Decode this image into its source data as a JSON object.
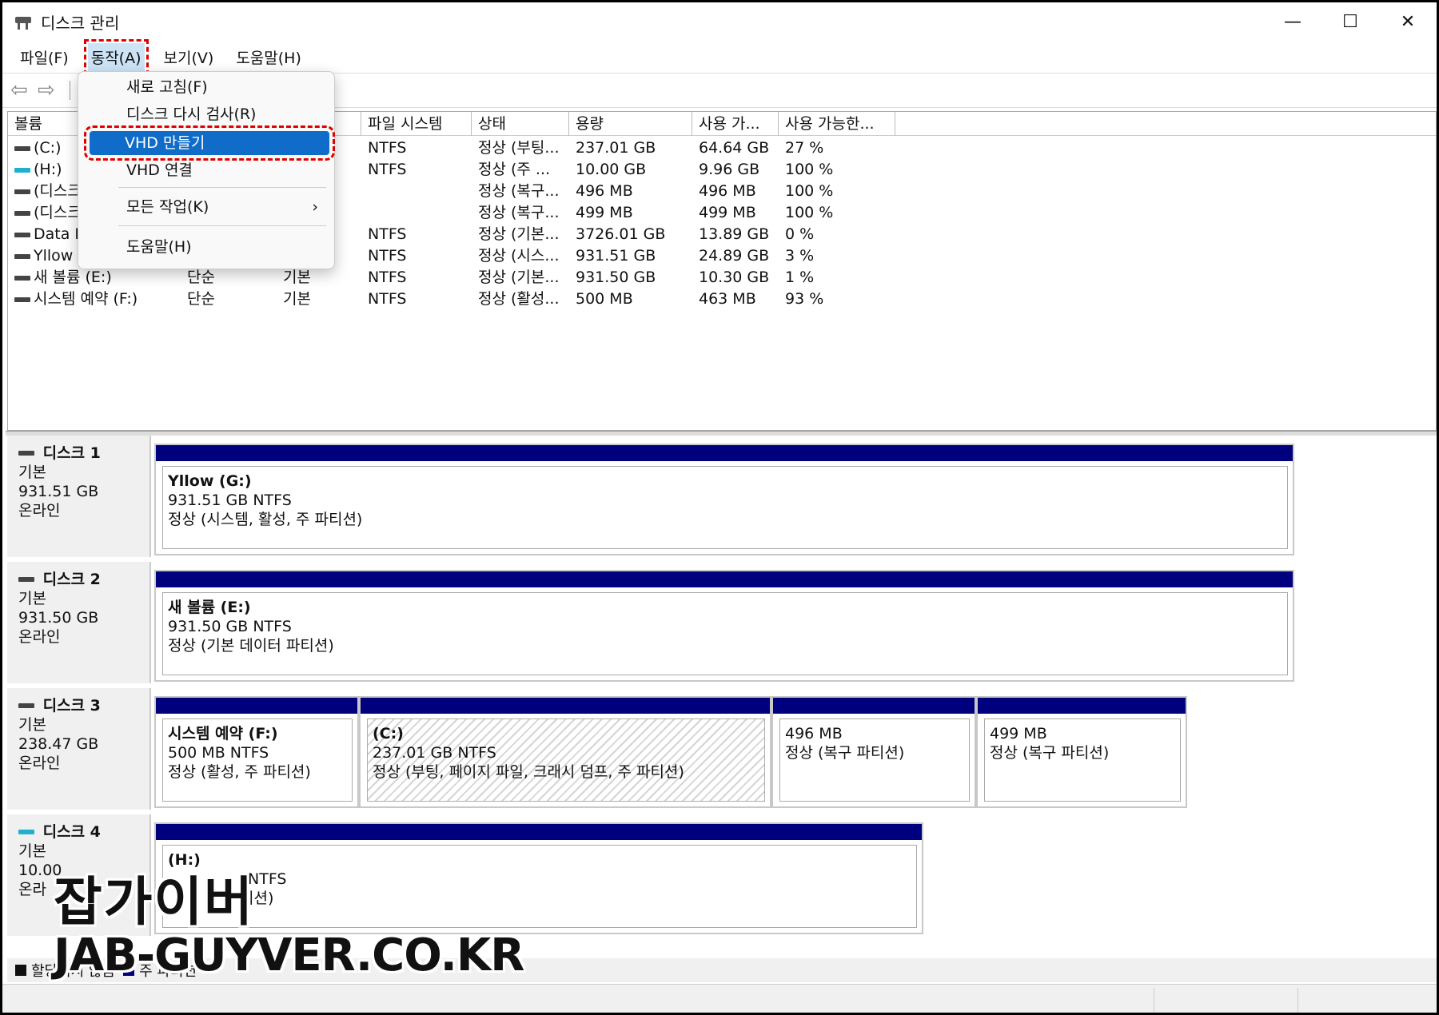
{
  "window": {
    "title": "디스크 관리",
    "minimize": "—",
    "maximize": "☐",
    "close": "✕"
  },
  "menubar": [
    "파일(F)",
    "동작(A)",
    "보기(V)",
    "도움말(H)"
  ],
  "toolbar": {
    "back": "⇦",
    "forward": "⇨"
  },
  "columns": [
    "볼륨",
    "",
    "",
    "파일 시스템",
    "상태",
    "용량",
    "사용 가...",
    "사용 가능한..."
  ],
  "volumes": [
    {
      "name": "(C:)",
      "layout": "",
      "type": "",
      "fs": "NTFS",
      "status": "정상 (부팅...",
      "capacity": "237.01 GB",
      "free": "64.64 GB",
      "pct": "27 %"
    },
    {
      "name": "(H:)",
      "layout": "",
      "type": "",
      "fs": "NTFS",
      "status": "정상 (주 ...",
      "capacity": "10.00 GB",
      "free": "9.96 GB",
      "pct": "100 %"
    },
    {
      "name": "(디스크",
      "layout": "",
      "type": "",
      "fs": "",
      "status": "정상 (복구...",
      "capacity": "496 MB",
      "free": "496 MB",
      "pct": "100 %"
    },
    {
      "name": "(디스크",
      "layout": "",
      "type": "",
      "fs": "",
      "status": "정상 (복구...",
      "capacity": "499 MB",
      "free": "499 MB",
      "pct": "100 %"
    },
    {
      "name": "Data E",
      "layout": "",
      "type": "",
      "fs": "NTFS",
      "status": "정상 (기본...",
      "capacity": "3726.01 GB",
      "free": "13.89 GB",
      "pct": "0 %"
    },
    {
      "name": "Yllow",
      "layout": "",
      "type": "",
      "fs": "NTFS",
      "status": "정상 (시스...",
      "capacity": "931.51 GB",
      "free": "24.89 GB",
      "pct": "3 %"
    },
    {
      "name": "새 볼륨 (E:)",
      "layout": "단순",
      "type": "기본",
      "fs": "NTFS",
      "status": "정상 (기본...",
      "capacity": "931.50 GB",
      "free": "10.30 GB",
      "pct": "1 %"
    },
    {
      "name": "시스템 예약 (F:)",
      "layout": "단순",
      "type": "기본",
      "fs": "NTFS",
      "status": "정상 (활성...",
      "capacity": "500 MB",
      "free": "463 MB",
      "pct": "93 %"
    }
  ],
  "action_menu": {
    "refresh": "새로 고침(F)",
    "rescan": "디스크 다시 검사(R)",
    "create_vhd": "VHD 만들기",
    "attach_vhd": "VHD 연결",
    "all_tasks": "모든 작업(K)",
    "all_tasks_chevron": "›",
    "help": "도움말(H)"
  },
  "disks": [
    {
      "name": "디스크 1",
      "type": "기본",
      "size": "931.51 GB",
      "state": "온라인",
      "partitions": [
        {
          "label": "Yllow  (G:)",
          "detail": "931.51 GB NTFS",
          "status": "정상 (시스템, 활성, 주 파티션)"
        }
      ]
    },
    {
      "name": "디스크 2",
      "type": "기본",
      "size": "931.50 GB",
      "state": "온라인",
      "partitions": [
        {
          "label": "새 볼륨  (E:)",
          "detail": "931.50 GB NTFS",
          "status": "정상 (기본 데이터 파티션)"
        }
      ]
    },
    {
      "name": "디스크 3",
      "type": "기본",
      "size": "238.47 GB",
      "state": "온라인",
      "partitions": [
        {
          "label": "시스템 예약  (F:)",
          "detail": "500 MB NTFS",
          "status": "정상 (활성, 주 파티션)"
        },
        {
          "label": "(C:)",
          "detail": "237.01 GB NTFS",
          "status": "정상 (부팅, 페이지 파일, 크래시 덤프, 주 파티션)"
        },
        {
          "label": "",
          "detail": "496 MB",
          "status": "정상 (복구 파티션)"
        },
        {
          "label": "",
          "detail": "499 MB",
          "status": "정상 (복구 파티션)"
        }
      ]
    },
    {
      "name": "디스크 4",
      "type": "기본",
      "size": "10.00",
      "state": "온라",
      "partitions": [
        {
          "label": "(H:)",
          "detail": "NTFS",
          "status": "티션)"
        }
      ]
    }
  ],
  "legend": {
    "unallocated": "할당되지 않음",
    "primary": "주 파티션"
  },
  "watermark": {
    "line1": "잡가이버",
    "line2": "JAB-GUYVER.CO.KR"
  }
}
